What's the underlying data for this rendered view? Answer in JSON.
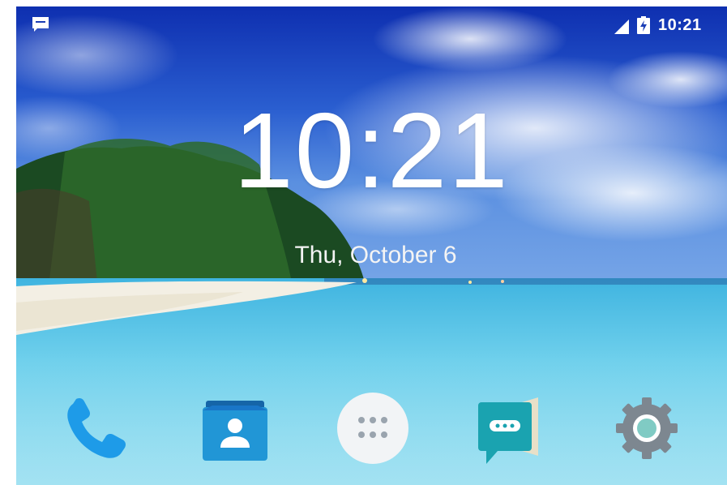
{
  "status_bar": {
    "time": "10:21",
    "icons": [
      "message-notification-icon",
      "cell-signal-icon",
      "battery-charging-icon"
    ]
  },
  "lock_screen": {
    "time": "10:21",
    "date": "Thu, October 6"
  },
  "dock": {
    "apps": [
      {
        "name": "Phone",
        "icon": "phone-icon"
      },
      {
        "name": "Contacts",
        "icon": "contacts-icon"
      },
      {
        "name": "All apps",
        "icon": "app-drawer-icon"
      },
      {
        "name": "Messaging",
        "icon": "messaging-icon"
      },
      {
        "name": "Settings",
        "icon": "settings-gear-icon"
      }
    ]
  },
  "colors": {
    "sky_top": "#1336b8",
    "sky_mid": "#3d78d8",
    "sea": "#52c5e8",
    "sand": "#f2efe6",
    "phone_blue": "#1e9be8",
    "contacts_blue": "#2196d6",
    "messaging_teal": "#1aa3b0",
    "settings_gray": "#7d8790",
    "settings_teal": "#80cbc4"
  }
}
